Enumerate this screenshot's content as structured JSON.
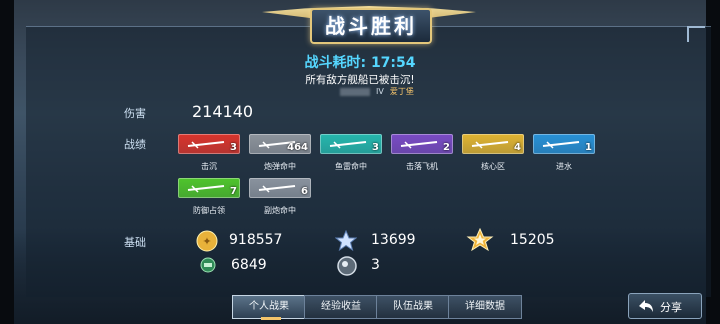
{
  "header": {
    "title": "战斗胜利",
    "duration": "战斗耗时: 17:54",
    "subtitle": "所有敌方舰船已被击沉!",
    "mvp_tier": "IV",
    "mvp_name": "爱丁堡"
  },
  "damage": {
    "label": "伤害",
    "value": "214140"
  },
  "record": {
    "label": "战绩",
    "medals": [
      {
        "caption": "击沉",
        "count": "3",
        "color": "#d9342c",
        "icon": "sunk-icon"
      },
      {
        "caption": "炮弹命中",
        "count": "464",
        "color": "#8d939b",
        "icon": "shell-hit-icon"
      },
      {
        "caption": "鱼雷命中",
        "count": "3",
        "color": "#25b7ad",
        "icon": "torpedo-hit-icon"
      },
      {
        "caption": "击落飞机",
        "count": "2",
        "color": "#7a4bc4",
        "icon": "plane-shot-icon"
      },
      {
        "caption": "核心区",
        "count": "4",
        "color": "#e0b432",
        "icon": "citadel-icon"
      },
      {
        "caption": "进水",
        "count": "1",
        "color": "#2891d6",
        "icon": "flooding-icon"
      },
      {
        "caption": "防御占领",
        "count": "7",
        "color": "#4fc52c",
        "icon": "defend-icon"
      },
      {
        "caption": "副炮命中",
        "count": "6",
        "color": "#8a939e",
        "icon": "secondary-hit-icon"
      }
    ]
  },
  "basic": {
    "label": "基础",
    "credits": "918557",
    "exp": "13699",
    "captain_exp": "15205",
    "free_exp": "6849",
    "other": "3"
  },
  "tabs": [
    "个人战果",
    "经验收益",
    "队伍战果",
    "详细数据"
  ],
  "share_label": "分享"
}
